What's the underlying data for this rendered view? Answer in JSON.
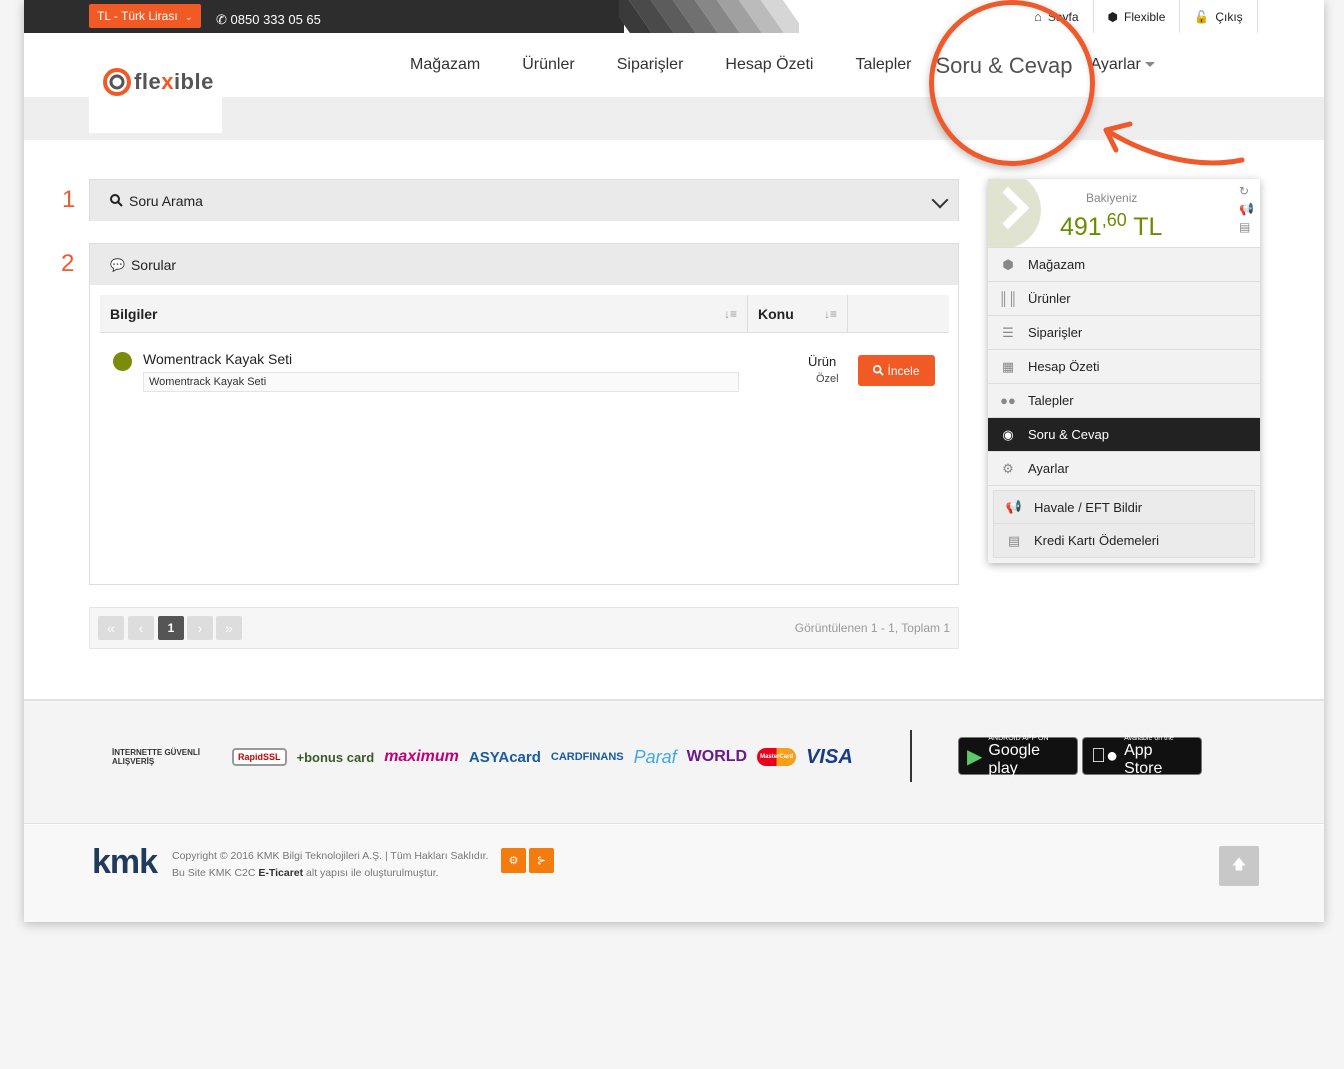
{
  "topbar": {
    "currency": "TL - Türk Lirası",
    "phone": "0850 333 05 65",
    "links": [
      {
        "label": "Sayfa",
        "icon": "home-icon"
      },
      {
        "label": "Flexible",
        "icon": "cube-icon"
      },
      {
        "label": "Çıkış",
        "icon": "unlock-icon"
      }
    ]
  },
  "logo": {
    "pre": "fle",
    "x": "x",
    "post": "ible"
  },
  "nav": {
    "items": [
      "Mağazam",
      "Ürünler",
      "Siparişler",
      "Hesap Özeti",
      "Talepler"
    ],
    "highlighted": "Soru & Cevap",
    "settings": "Ayarlar"
  },
  "steps": [
    "1",
    "2"
  ],
  "search_panel": {
    "title": "Soru Arama"
  },
  "questions_panel": {
    "title": "Sorular",
    "columns": [
      "Bilgiler",
      "Konu"
    ],
    "rows": [
      {
        "title": "Womentrack Kayak Seti",
        "subtitle": "Womentrack Kayak Seti",
        "konu": "Ürün",
        "konu_sub": "Özel",
        "button": "İncele",
        "status_color": "#7a8c0a"
      }
    ]
  },
  "pager": {
    "first": "«",
    "prev": "‹",
    "current": "1",
    "next": "›",
    "last": "»",
    "info": "Görüntülenen 1 - 1, Toplam 1"
  },
  "sidebar": {
    "balance_label": "Bakiyeniz",
    "balance_int": "491",
    "balance_dec": ",60",
    "currency": "TL",
    "items": [
      {
        "label": "Mağazam",
        "icon": "cube-icon"
      },
      {
        "label": "Ürünler",
        "icon": "barcode-icon"
      },
      {
        "label": "Siparişler",
        "icon": "list-icon"
      },
      {
        "label": "Hesap Özeti",
        "icon": "calculator-icon"
      },
      {
        "label": "Talepler",
        "icon": "users-icon"
      },
      {
        "label": "Soru & Cevap",
        "icon": "comment-icon"
      },
      {
        "label": "Ayarlar",
        "icon": "gears-icon"
      }
    ],
    "sub_items": [
      {
        "label": "Havale / EFT Bildir",
        "icon": "megaphone-icon"
      },
      {
        "label": "Kredi Kartı Ödemeleri",
        "icon": "credit-card-icon"
      }
    ]
  },
  "footer": {
    "payment_logos": [
      "İNTERNETTE GÜVENLİ ALIŞVERİŞ",
      "RapidSSL",
      "+bonus card",
      "maximum",
      "ASYAcard",
      "CARDFINANS",
      "Paraf",
      "WORLD",
      "MasterCard",
      "VISA"
    ],
    "google_play": {
      "small": "ANDROID APP ON",
      "big": "Google play"
    },
    "app_store": {
      "small": "Available on the",
      "big": "App Store"
    },
    "kmk": "kmk",
    "copyright": "Copyright © 2016 KMK Bilgi Teknolojileri A.Ş. | Tüm Hakları Saklıdır.",
    "built_pre": "Bu Site KMK C2C",
    "built_bold": "E-Ticaret",
    "built_post": "alt yapısı ile oluşturulmuştur."
  },
  "colors": {
    "accent": "#f15a24",
    "balance": "#6a8c00",
    "active_bg": "#222222"
  }
}
